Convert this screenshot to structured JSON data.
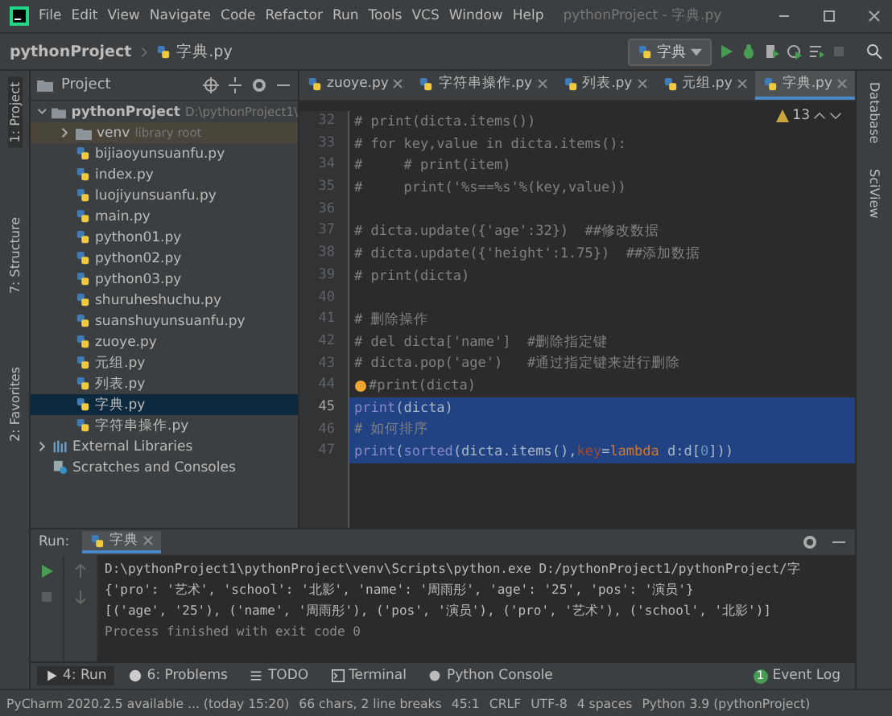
{
  "window": {
    "title": "pythonProject - 字典.py"
  },
  "menu": [
    "File",
    "Edit",
    "View",
    "Navigate",
    "Code",
    "Refactor",
    "Run",
    "Tools",
    "VCS",
    "Window",
    "Help"
  ],
  "breadcrumbs": [
    "pythonProject",
    "字典.py"
  ],
  "run_config": {
    "label": "字典"
  },
  "left_strip": [
    "1: Project",
    "7: Structure",
    "2: Favorites"
  ],
  "right_strip": [
    "Database",
    "SciView"
  ],
  "project_panel": {
    "title": "Project",
    "tree": [
      {
        "label": "pythonProject",
        "hint": "D:\\pythonProject1\\",
        "kind": "project",
        "expanded": true,
        "selected": false,
        "children": [
          {
            "label": "venv",
            "hint": "library root",
            "kind": "folder",
            "expanded": false,
            "selected": false
          },
          {
            "label": "bijiaoyunsuanfu.py",
            "kind": "file",
            "selected": false
          },
          {
            "label": "index.py",
            "kind": "file",
            "selected": false
          },
          {
            "label": "luojiyunsuanfu.py",
            "kind": "file",
            "selected": false
          },
          {
            "label": "main.py",
            "kind": "file",
            "selected": false
          },
          {
            "label": "python01.py",
            "kind": "file",
            "selected": false
          },
          {
            "label": "python02.py",
            "kind": "file",
            "selected": false
          },
          {
            "label": "python03.py",
            "kind": "file",
            "selected": false
          },
          {
            "label": "shuruheshuchu.py",
            "kind": "file",
            "selected": false
          },
          {
            "label": "suanshuyunsuanfu.py",
            "kind": "file",
            "selected": false
          },
          {
            "label": "zuoye.py",
            "kind": "file",
            "selected": false
          },
          {
            "label": "元组.py",
            "kind": "file",
            "selected": false
          },
          {
            "label": "列表.py",
            "kind": "file",
            "selected": false
          },
          {
            "label": "字典.py",
            "kind": "file",
            "selected": true
          },
          {
            "label": "字符串操作.py",
            "kind": "file",
            "selected": false
          }
        ]
      },
      {
        "label": "External Libraries",
        "kind": "library",
        "expanded": false,
        "selected": false
      },
      {
        "label": "Scratches and Consoles",
        "kind": "scratches",
        "selected": false
      }
    ]
  },
  "editor_tabs": [
    {
      "label": "zuoye.py",
      "selected": false
    },
    {
      "label": "字符串操作.py",
      "selected": false
    },
    {
      "label": "列表.py",
      "selected": false
    },
    {
      "label": "元组.py",
      "selected": false
    },
    {
      "label": "字典.py",
      "selected": true
    }
  ],
  "editor": {
    "warnings": "13",
    "lines": [
      {
        "number": "32",
        "selected": false,
        "current": false,
        "bulb": false,
        "segments": [
          {
            "text": "# print(dicta.items())",
            "kind": "comment"
          }
        ]
      },
      {
        "number": "33",
        "selected": false,
        "current": false,
        "bulb": false,
        "segments": [
          {
            "text": "# for key,value in dicta.items():",
            "kind": "comment"
          }
        ]
      },
      {
        "number": "34",
        "selected": false,
        "current": false,
        "bulb": false,
        "segments": [
          {
            "text": "#     # print(item)",
            "kind": "comment"
          }
        ]
      },
      {
        "number": "35",
        "selected": false,
        "current": false,
        "bulb": false,
        "segments": [
          {
            "text": "#     print('%s==%s'%(key,value))",
            "kind": "comment"
          }
        ]
      },
      {
        "number": "36",
        "selected": false,
        "current": false,
        "bulb": false
      },
      {
        "number": "37",
        "selected": false,
        "current": false,
        "bulb": false,
        "segments": [
          {
            "text": "# dicta.update({'age':32})  ##修改数据",
            "kind": "comment"
          }
        ]
      },
      {
        "number": "38",
        "selected": false,
        "current": false,
        "bulb": false,
        "segments": [
          {
            "text": "# dicta.update({'height':1.75})  ##添加数据",
            "kind": "comment"
          }
        ]
      },
      {
        "number": "39",
        "selected": false,
        "current": false,
        "bulb": false,
        "segments": [
          {
            "text": "# print(dicta)",
            "kind": "comment"
          }
        ]
      },
      {
        "number": "40",
        "selected": false,
        "current": false,
        "bulb": false
      },
      {
        "number": "41",
        "selected": false,
        "current": false,
        "bulb": false,
        "segments": [
          {
            "text": "# 删除操作",
            "kind": "comment"
          }
        ]
      },
      {
        "number": "42",
        "selected": false,
        "current": false,
        "bulb": false,
        "segments": [
          {
            "text": "# del dicta['name']  #删除指定键",
            "kind": "comment"
          }
        ]
      },
      {
        "number": "43",
        "selected": false,
        "current": false,
        "bulb": false,
        "segments": [
          {
            "text": "# dicta.pop('age')   #通过指定键来进行删除",
            "kind": "comment"
          }
        ]
      },
      {
        "number": "44",
        "selected": false,
        "current": false,
        "bulb": true,
        "segments": [
          {
            "text": "#print(dicta)",
            "kind": "comment"
          }
        ]
      },
      {
        "number": "45",
        "selected": true,
        "current": true,
        "bulb": false,
        "segments": [
          {
            "text": "print",
            "kind": "builtin"
          },
          {
            "text": "(dicta)",
            "kind": "plain"
          }
        ]
      },
      {
        "number": "46",
        "selected": true,
        "current": false,
        "bulb": false,
        "segments": [
          {
            "text": "# 如何排序",
            "kind": "comment"
          }
        ]
      },
      {
        "number": "47",
        "selected": true,
        "current": false,
        "bulb": false,
        "segments": [
          {
            "text": "print",
            "kind": "builtin"
          },
          {
            "text": "(",
            "kind": "plain"
          },
          {
            "text": "sorted",
            "kind": "builtin"
          },
          {
            "text": "(dicta.items(),",
            "kind": "plain"
          },
          {
            "text": "key",
            "kind": "param"
          },
          {
            "text": "=",
            "kind": "plain"
          },
          {
            "text": "lambda",
            "kind": "keyword"
          },
          {
            "text": " d:d[",
            "kind": "plain"
          },
          {
            "text": "0",
            "kind": "number"
          },
          {
            "text": "]))",
            "kind": "plain"
          }
        ]
      }
    ]
  },
  "run_panel": {
    "label": "Run:",
    "tabs": [
      {
        "label": "字典",
        "selected": true
      }
    ],
    "output": [
      {
        "text": "D:\\pythonProject1\\pythonProject\\venv\\Scripts\\python.exe D:/pythonProject1/pythonProject/字",
        "kind": "command"
      },
      {
        "text": "{'pro': '艺术', 'school': '北影', 'name': '周雨彤', 'age': '25', 'pos': '演员'}",
        "kind": "output"
      },
      {
        "text": "[('age', '25'), ('name', '周雨彤'), ('pos', '演员'), ('pro', '艺术'), ('school', '北影')]",
        "kind": "output"
      },
      {
        "text": "Process finished with exit code 0",
        "kind": "status"
      }
    ]
  },
  "tool_windows": [
    {
      "label": "4: Run",
      "kind": "run",
      "selected": true
    },
    {
      "label": "6: Problems",
      "kind": "problems",
      "selected": false
    },
    {
      "label": "TODO",
      "kind": "todo",
      "selected": false
    },
    {
      "label": "Terminal",
      "kind": "terminal",
      "selected": false
    },
    {
      "label": "Python Console",
      "kind": "console",
      "selected": false
    }
  ],
  "event_log": {
    "label": "Event Log",
    "count": "1"
  },
  "status_bar": [
    "PyCharm 2020.2.5 available ... (today 15:20)",
    "66 chars, 2 line breaks",
    "45:1",
    "CRLF",
    "UTF-8",
    "4 spaces",
    "Python 3.9 (pythonProject)"
  ]
}
